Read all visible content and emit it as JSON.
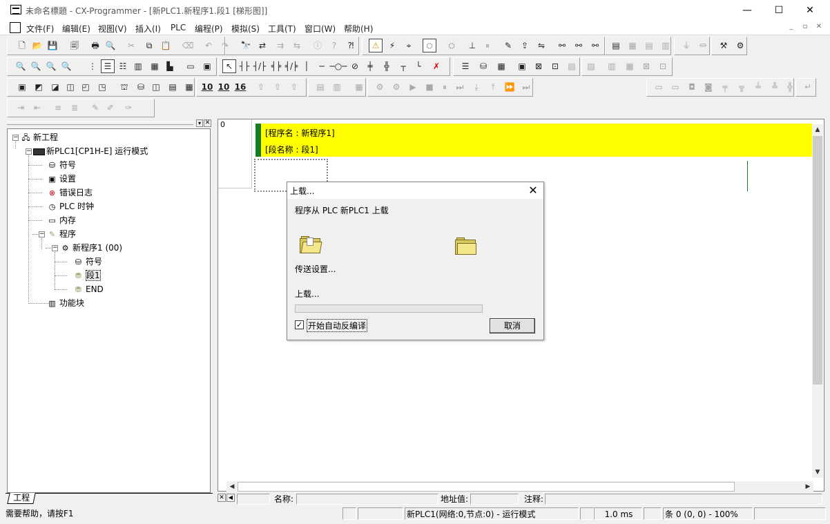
{
  "window": {
    "title": "未命名標題 - CX-Programmer - [新PLC1.新程序1.段1 [梯形图]]",
    "minimize": "—",
    "maximize": "☐",
    "close": "✕"
  },
  "menu": [
    "文件(F)",
    "编辑(E)",
    "视图(V)",
    "插入(I)",
    "PLC",
    "编程(P)",
    "模拟(S)",
    "工具(T)",
    "窗口(W)",
    "帮助(H)"
  ],
  "mdi": {
    "minimize": "_",
    "restore": "▫",
    "close": "✕"
  },
  "toolbar": {
    "row1": [
      "new-icon",
      "open-icon",
      "save-icon",
      "print-preview-icon",
      "print-icon",
      "preview-icon",
      "cut-icon",
      "copy-icon",
      "paste-icon",
      "delete-icon",
      "undo-icon",
      "redo-icon",
      "find-icon",
      "replace-icon",
      "find-next-icon",
      "replace-next-icon",
      "about-icon",
      "help-icon",
      "context-help-icon",
      "warning-icon",
      "error-icon",
      "find-errors-icon",
      "compile-icon",
      "watch-icon",
      "monitor-icon",
      "pause-icon",
      "online-edit-icon",
      "transfer-icon",
      "compare-icon",
      "link-icon",
      "link2-icon",
      "link3-icon",
      "window1-icon",
      "window2-icon",
      "window3-icon",
      "window4-icon",
      "io-icon",
      "io2-icon",
      "tool-icon",
      "tool2-icon"
    ],
    "row2": [
      "zoom-small-icon",
      "zoom-in-icon",
      "zoom-fit-icon",
      "zoom-out-icon",
      "grid-icon",
      "comment-icon",
      "list-icon",
      "rung-icon",
      "table-icon",
      "tree-icon",
      "sm-icon",
      "ct-icon",
      "select-cursor-icon",
      "contact-no-icon",
      "contact-nc-icon",
      "contact-or-icon",
      "contact-or-nc-icon",
      "vertical-line-icon",
      "horizontal-line-icon",
      "coil-icon",
      "coil-nc-icon",
      "instruction-icon",
      "instruction2-icon",
      "branch-icon",
      "branch-end-icon",
      "delete-line-icon",
      "stack-icon",
      "stack2-icon",
      "stack3-icon",
      "mem-icon",
      "mem2-icon",
      "mem3-icon",
      "mem4-icon",
      "mem5-icon",
      "mon1-icon",
      "mon2-icon",
      "mon3-icon",
      "mon4-icon"
    ],
    "row3": [
      "view1-icon",
      "view2-icon",
      "view3-icon",
      "view4-icon",
      "view5-icon",
      "view6-icon",
      "view7-icon",
      "view8-icon",
      "view9-icon",
      "view10-icon",
      "view11-icon",
      "hex10-icon",
      "hex10b-icon",
      "hex16-icon",
      "up-icon",
      "up2-icon",
      "up3-icon",
      "plc1-icon",
      "plc2-icon",
      "plc3-icon",
      "step-icon",
      "step2-icon",
      "run-icon",
      "stop-icon",
      "pause2-icon",
      "step-run-icon",
      "step-into-icon",
      "step-back-icon",
      "fast-forward-icon",
      "step-end-icon"
    ],
    "row3_right": [
      "r1-icon",
      "r2-icon",
      "r3-icon",
      "r4-icon",
      "r5-icon",
      "r6-icon",
      "r7-icon",
      "r8-icon",
      "r9-icon",
      "r10-icon"
    ],
    "row4": [
      "indent-icon",
      "outdent-icon",
      "align-icon",
      "align2-icon",
      "tool-a-icon",
      "tool-b-icon",
      "tool-c-icon"
    ]
  },
  "tree": {
    "root": "新工程",
    "plc": "新PLC1[CP1H-E] 运行模式",
    "items": [
      "符号",
      "设置",
      "错误日志",
      "PLC 时钟",
      "内存",
      "程序"
    ],
    "program": "新程序1 (00)",
    "program_items": [
      "符号",
      "段1",
      "END"
    ],
    "function_block": "功能块",
    "tab": "工程"
  },
  "ladder": {
    "rung_number": "0",
    "program_name": "[程序名 : 新程序1]",
    "section_name": "[段名称 : 段1]"
  },
  "bottom": {
    "name_label": "名称:",
    "address_label": "地址值:",
    "comment_label": "注释:"
  },
  "status": {
    "help": "需要帮助，请按F1",
    "plc": "新PLC1(网络:0,节点:0) - 运行模式",
    "cycle": "1.0 ms",
    "rung": "条 0 (0, 0)  - 100%"
  },
  "dialog": {
    "title": "上载...",
    "message": "程序从 PLC 新PLC1 上载",
    "transfer": "传送设置...",
    "uploading": "上载...",
    "progress": 0,
    "checkbox_label": "开始自动反编译",
    "checkbox_checked": true,
    "cancel": "取消"
  }
}
